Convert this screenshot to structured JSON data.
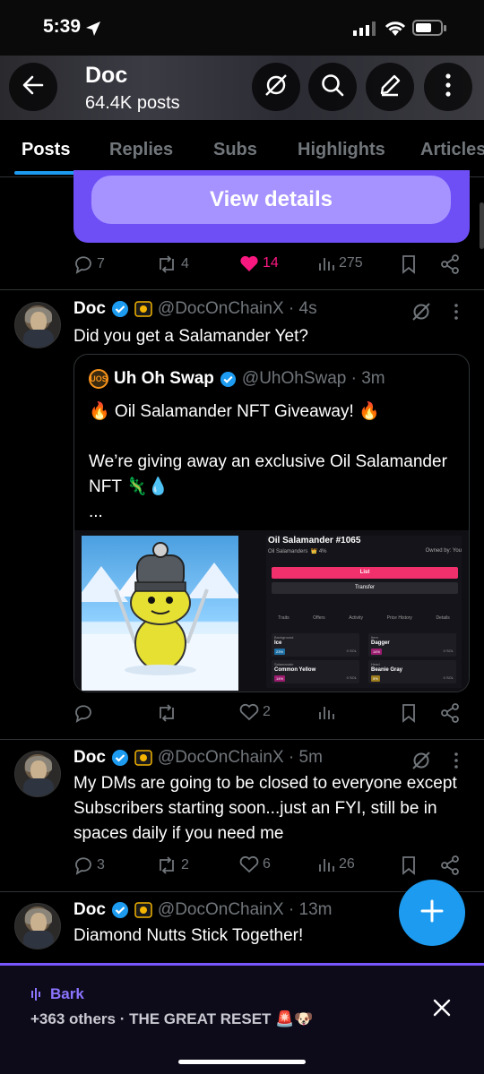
{
  "status": {
    "time": "5:39"
  },
  "header": {
    "title": "Doc",
    "subtitle": "64.4K posts"
  },
  "tabs": [
    "Posts",
    "Replies",
    "Subs",
    "Highlights",
    "Articles"
  ],
  "prev_post": {
    "button": "View details",
    "replies": "7",
    "reposts": "4",
    "likes": "14",
    "views": "275"
  },
  "tweet1": {
    "name": "Doc",
    "handle": "@DocOnChainX · 4s",
    "text": "Did you get a Salamander Yet?",
    "quote": {
      "logo": "UOS",
      "name": "Uh Oh Swap",
      "handle": "@UhOhSwap · 3m",
      "line1": "🔥 Oil Salamander NFT Giveaway! 🔥",
      "line2": "We’re giving away an exclusive Oil Salamander NFT 🦎💧",
      "line3": "...",
      "media": {
        "title": "Oil Salamander #1065",
        "collection": "Oil Salamanders",
        "rank": "4%",
        "owned": "Owned by: You",
        "list": "List",
        "transfer": "Transfer",
        "tabs": [
          "Traits",
          "Offers",
          "Activity",
          "Price History",
          "Details"
        ],
        "traits": [
          {
            "key": "Background",
            "value": "Ice",
            "pct": "23%",
            "price": "0 SOL",
            "color": "#1d6fa5"
          },
          {
            "key": "Item",
            "value": "Dagger",
            "pct": "14%",
            "price": "0 SOL",
            "color": "#9b1d6f"
          },
          {
            "key": "Salamander",
            "value": "Common Yellow",
            "pct": "14%",
            "price": "0 SOL",
            "color": "#9b1d6f"
          },
          {
            "key": "Head",
            "value": "Beanie Gray",
            "pct": "5%",
            "price": "0 SOL",
            "color": "#9b7b1d"
          }
        ]
      }
    },
    "replies": "",
    "reposts": "",
    "likes": "2",
    "views": ""
  },
  "tweet2": {
    "name": "Doc",
    "handle": "@DocOnChainX · 5m",
    "text": "My DMs are going to be closed to everyone except Subscribers starting soon...just an FYI, still be in spaces daily if you need me",
    "replies": "3",
    "reposts": "2",
    "likes": "6",
    "views": "26"
  },
  "tweet3": {
    "name": "Doc",
    "handle": "@DocOnChainX · 13m",
    "text": "Diamond Nutts Stick Together!"
  },
  "spaces": {
    "title": "Bark",
    "subtitle": "+363 others · THE GREAT RESET 🚨🐶"
  },
  "colors": {
    "accent": "#1d9bf0",
    "like": "#f91880",
    "space": "#7856ff"
  }
}
